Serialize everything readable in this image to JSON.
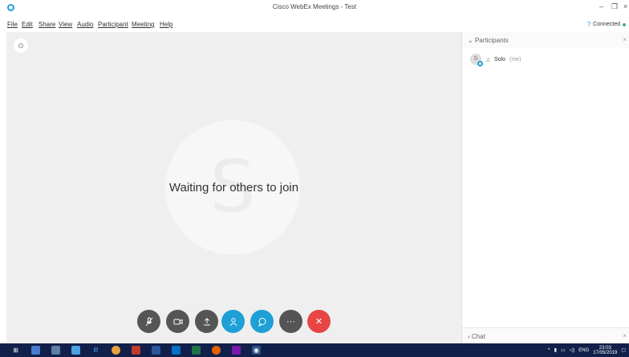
{
  "window": {
    "title": "Cisco WebEx Meetings - Test"
  },
  "menu": [
    {
      "label": "File"
    },
    {
      "label": "Edit"
    },
    {
      "label": "Share"
    },
    {
      "label": "View"
    },
    {
      "label": "Audio"
    },
    {
      "label": "Participant"
    },
    {
      "label": "Meeting"
    },
    {
      "label": "Help"
    }
  ],
  "connection": {
    "status": "Connected",
    "color": "#3cb371"
  },
  "stage": {
    "message": "Waiting for others to join",
    "avatar_letter": "S"
  },
  "controls": [
    {
      "name": "mute",
      "icon": "microphone-muted-icon"
    },
    {
      "name": "video",
      "icon": "video-camera-icon"
    },
    {
      "name": "share",
      "icon": "share-upload-icon"
    },
    {
      "name": "participants",
      "icon": "participants-icon"
    },
    {
      "name": "chat",
      "icon": "chat-bubble-icon"
    },
    {
      "name": "more",
      "icon": "more-options-icon"
    },
    {
      "name": "leave",
      "icon": "close-icon"
    }
  ],
  "panel": {
    "participants_label": "Participants",
    "chat_label": "Chat",
    "participant": {
      "initial": "S",
      "name": "Solo",
      "role": "(me)"
    }
  },
  "taskbar": {
    "language": "ENG",
    "time": "23:03",
    "date": "17/05/2019"
  },
  "colors": {
    "accent": "#1e9fd6",
    "leave": "#e84545",
    "taskbar": "#10204a"
  }
}
